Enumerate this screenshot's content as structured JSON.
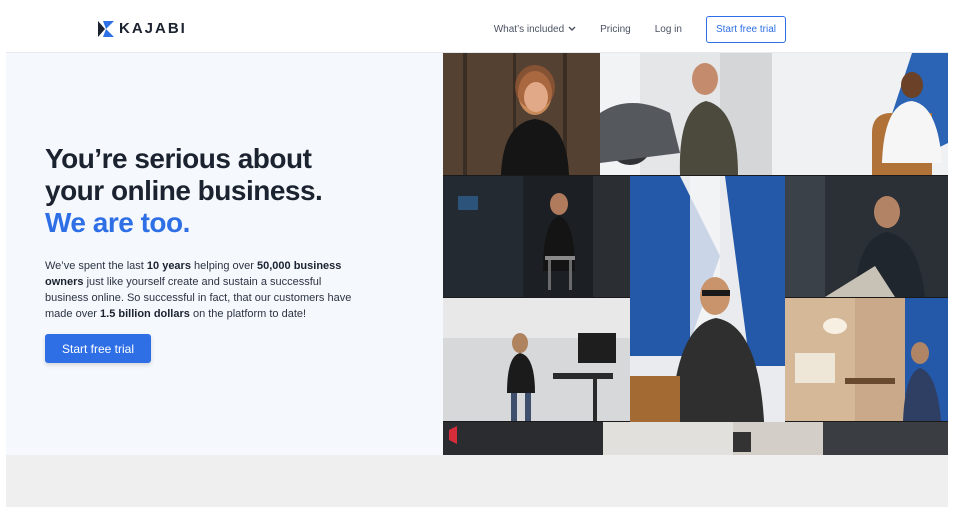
{
  "header": {
    "brand": "KAJABI",
    "nav": {
      "whats_included": "What’s included",
      "pricing": "Pricing",
      "login": "Log in",
      "cta": "Start free trial"
    }
  },
  "hero": {
    "headline_line1": "You’re serious about",
    "headline_line2": "your online business.",
    "headline_accent": "We are too.",
    "lede": {
      "p1": "We’ve spent the last ",
      "b1": "10 years",
      "p2": " helping over ",
      "b2": "50,000 business owners",
      "p3": " just like yourself create and sustain a successful business online. So successful in fact, that our customers have made over ",
      "b3": "1.5 billion dollars",
      "p4": " on the platform to date!"
    },
    "cta": "Start free trial"
  },
  "colors": {
    "accent": "#2e6fe6",
    "hero_bg": "#f5f8fc",
    "footer_bg": "#efefef"
  }
}
